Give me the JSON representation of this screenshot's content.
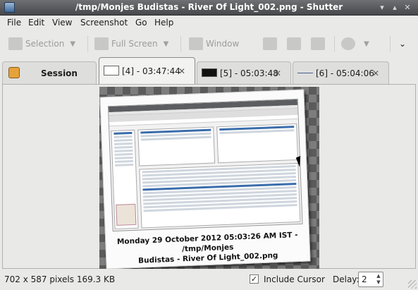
{
  "window": {
    "title": "/tmp/Monjes Budistas - River Of Light_002.png - Shutter"
  },
  "menu": {
    "items": [
      "File",
      "Edit",
      "View",
      "Screenshot",
      "Go",
      "Help"
    ]
  },
  "toolbar": {
    "selection": "Selection",
    "full_screen": "Full Screen",
    "window": "Window"
  },
  "tabs": {
    "session": "Session",
    "items": [
      {
        "label": "[4] - 03:47:44",
        "thumb": "window"
      },
      {
        "label": "[5] - 05:03:48",
        "thumb": "black"
      },
      {
        "label": "[6] - 05:04:06",
        "thumb": "line"
      }
    ]
  },
  "preview": {
    "caption_line1": "Monday 29 October 2012 05:03:26 AM IST - /tmp/Monjes",
    "caption_line2": "Budistas - River Of Light_002.png"
  },
  "status": {
    "image_info": "702 x 587 pixels  169.3 KB",
    "include_cursor_label": "Include Cursor",
    "include_cursor_checked": true,
    "delay_label": "Delay:",
    "delay_value": "2"
  },
  "colors": {
    "selection": "#3a6dab",
    "titlebar": "#55565a"
  }
}
